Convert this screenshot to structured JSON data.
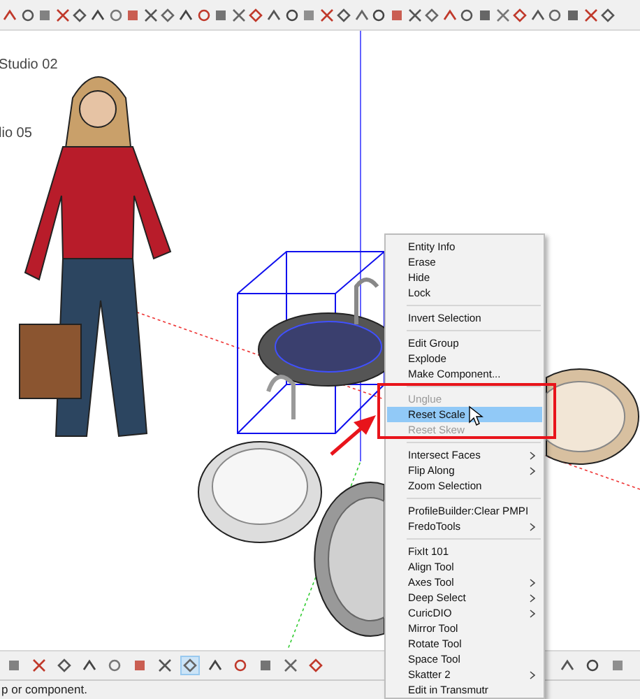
{
  "canvas": {
    "labels": [
      "Studio 02",
      "lio 05"
    ]
  },
  "context_menu": {
    "items": [
      {
        "kind": "item",
        "label": "Entity Info",
        "disabled": false,
        "selected": false,
        "submenu": false
      },
      {
        "kind": "item",
        "label": "Erase",
        "disabled": false,
        "selected": false,
        "submenu": false
      },
      {
        "kind": "item",
        "label": "Hide",
        "disabled": false,
        "selected": false,
        "submenu": false
      },
      {
        "kind": "item",
        "label": "Lock",
        "disabled": false,
        "selected": false,
        "submenu": false
      },
      {
        "kind": "separator"
      },
      {
        "kind": "item",
        "label": "Invert Selection",
        "disabled": false,
        "selected": false,
        "submenu": false
      },
      {
        "kind": "separator"
      },
      {
        "kind": "item",
        "label": "Edit Group",
        "disabled": false,
        "selected": false,
        "submenu": false
      },
      {
        "kind": "item",
        "label": "Explode",
        "disabled": false,
        "selected": false,
        "submenu": false
      },
      {
        "kind": "item",
        "label": "Make Component...",
        "disabled": false,
        "selected": false,
        "submenu": false
      },
      {
        "kind": "separator"
      },
      {
        "kind": "item",
        "label": "Unglue",
        "disabled": true,
        "selected": false,
        "submenu": false
      },
      {
        "kind": "item",
        "label": "Reset Scale",
        "disabled": false,
        "selected": true,
        "submenu": false
      },
      {
        "kind": "item",
        "label": "Reset Skew",
        "disabled": true,
        "selected": false,
        "submenu": false
      },
      {
        "kind": "separator"
      },
      {
        "kind": "item",
        "label": "Intersect Faces",
        "disabled": false,
        "selected": false,
        "submenu": true
      },
      {
        "kind": "item",
        "label": "Flip Along",
        "disabled": false,
        "selected": false,
        "submenu": true
      },
      {
        "kind": "item",
        "label": "Zoom Selection",
        "disabled": false,
        "selected": false,
        "submenu": false
      },
      {
        "kind": "separator"
      },
      {
        "kind": "item",
        "label": "ProfileBuilder:Clear PMPI",
        "disabled": false,
        "selected": false,
        "submenu": false
      },
      {
        "kind": "item",
        "label": "FredoTools",
        "disabled": false,
        "selected": false,
        "submenu": true
      },
      {
        "kind": "separator"
      },
      {
        "kind": "item",
        "label": "FixIt 101",
        "disabled": false,
        "selected": false,
        "submenu": false
      },
      {
        "kind": "item",
        "label": "Align Tool",
        "disabled": false,
        "selected": false,
        "submenu": false
      },
      {
        "kind": "item",
        "label": "Axes Tool",
        "disabled": false,
        "selected": false,
        "submenu": true
      },
      {
        "kind": "item",
        "label": "Deep Select",
        "disabled": false,
        "selected": false,
        "submenu": true
      },
      {
        "kind": "item",
        "label": "CuricDIO",
        "disabled": false,
        "selected": false,
        "submenu": true
      },
      {
        "kind": "item",
        "label": "Mirror Tool",
        "disabled": false,
        "selected": false,
        "submenu": false
      },
      {
        "kind": "item",
        "label": "Rotate Tool",
        "disabled": false,
        "selected": false,
        "submenu": false
      },
      {
        "kind": "item",
        "label": "Space Tool",
        "disabled": false,
        "selected": false,
        "submenu": false
      },
      {
        "kind": "item",
        "label": "Skatter 2",
        "disabled": false,
        "selected": false,
        "submenu": true
      },
      {
        "kind": "item",
        "label": "Edit in Transmutr",
        "disabled": false,
        "selected": false,
        "submenu": false
      }
    ]
  },
  "bottom_toolbar": {
    "buttons": [
      {
        "selected": false
      },
      {
        "selected": false
      },
      {
        "selected": false
      },
      {
        "selected": false
      },
      {
        "selected": false
      },
      {
        "selected": false
      },
      {
        "selected": false
      },
      {
        "selected": true
      },
      {
        "selected": false
      },
      {
        "selected": false
      },
      {
        "selected": false
      },
      {
        "selected": false
      },
      {
        "selected": false
      },
      {
        "selected": false
      },
      {
        "selected": false
      },
      {
        "selected": false
      }
    ]
  },
  "status_bar": {
    "text": "p or component."
  }
}
